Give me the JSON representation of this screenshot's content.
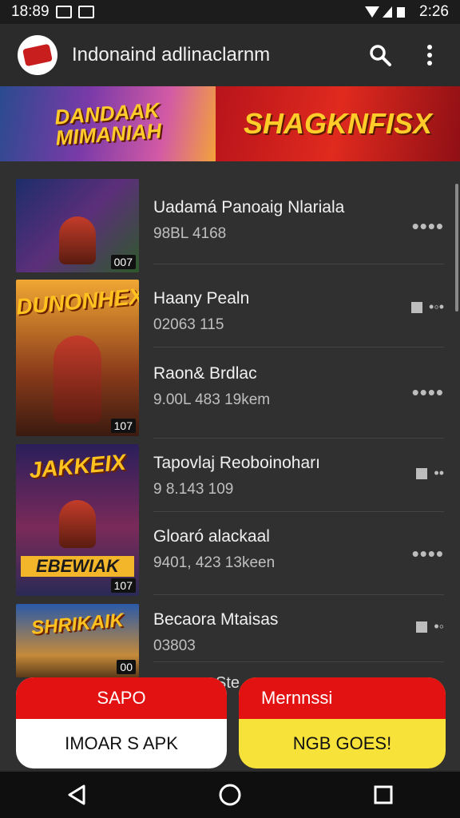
{
  "status_bar": {
    "time_left": "18:89",
    "time_right": "2:26"
  },
  "app_bar": {
    "title": "Indonaind adlinaclarnm",
    "icons": [
      "app-logo",
      "search-icon",
      "more-vert-icon"
    ]
  },
  "banner": {
    "left_text": "DANDAAK MIMANIAH",
    "right_text": "SHAGKNFISX"
  },
  "list": {
    "thumbnails": [
      {
        "tag": "007",
        "title": ""
      },
      {
        "tag": "107",
        "title": "DUNONHEX"
      },
      {
        "tag": "107",
        "title": "JAKKEIX",
        "subtitle": "EBEWIAK"
      },
      {
        "tag": "00",
        "title": "SHRIKAIK"
      }
    ],
    "items": [
      {
        "title": "Uadamá Panoaig Nlariala",
        "subtitle": "98BL 4168"
      },
      {
        "title": "Haany Pealn",
        "subtitle": "02063 115"
      },
      {
        "title": "Raon& Brdlac",
        "subtitle": "9.00L 483 19kem"
      },
      {
        "title": "Tapovlaj Reoboinoharı",
        "subtitle": "9 8.143 109"
      },
      {
        "title": "Gloaró alackaal",
        "subtitle": "9401, 423 13keen"
      },
      {
        "title": "Becaora Mtaisas",
        "subtitle": "03803"
      }
    ],
    "peek_text": "Ste"
  },
  "buttons": {
    "left": {
      "top_label": "SAPO",
      "bottom_label": "IMOAR S APK"
    },
    "right": {
      "top_label": "Mernnssi",
      "bottom_label": "NGB GOES!"
    }
  },
  "nav_bar": {
    "icons": [
      "back-icon",
      "home-icon",
      "recents-icon"
    ]
  },
  "colors": {
    "accent_red": "#e31212",
    "accent_yellow": "#f7e23a",
    "background": "#2b2b2b"
  }
}
